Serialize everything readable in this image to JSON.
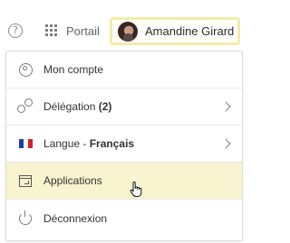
{
  "header": {
    "help_icon": "question-circle-icon",
    "help_glyph": "?",
    "portal_icon": "grid-icon",
    "portal_label": "Portail",
    "user_name": "Amandine Girard"
  },
  "menu": {
    "items": [
      {
        "icon": "user-circle-icon",
        "label": "Mon compte"
      },
      {
        "icon": "delegation-icon",
        "label": "Délégation",
        "count": "(2)",
        "has_submenu": true
      },
      {
        "icon": "flag-fr-icon",
        "label_prefix": "Langue - ",
        "label_strong": "Français",
        "has_submenu": true
      },
      {
        "icon": "applications-icon",
        "label": "Applications",
        "active": true
      },
      {
        "icon": "power-icon",
        "label": "Déconnexion"
      }
    ]
  },
  "colors": {
    "highlight": "#f7f4cf",
    "user_border": "#f2ecaa",
    "flag_blue": "#1f3fa8",
    "flag_white": "#ffffff",
    "flag_red": "#d71f2d"
  }
}
